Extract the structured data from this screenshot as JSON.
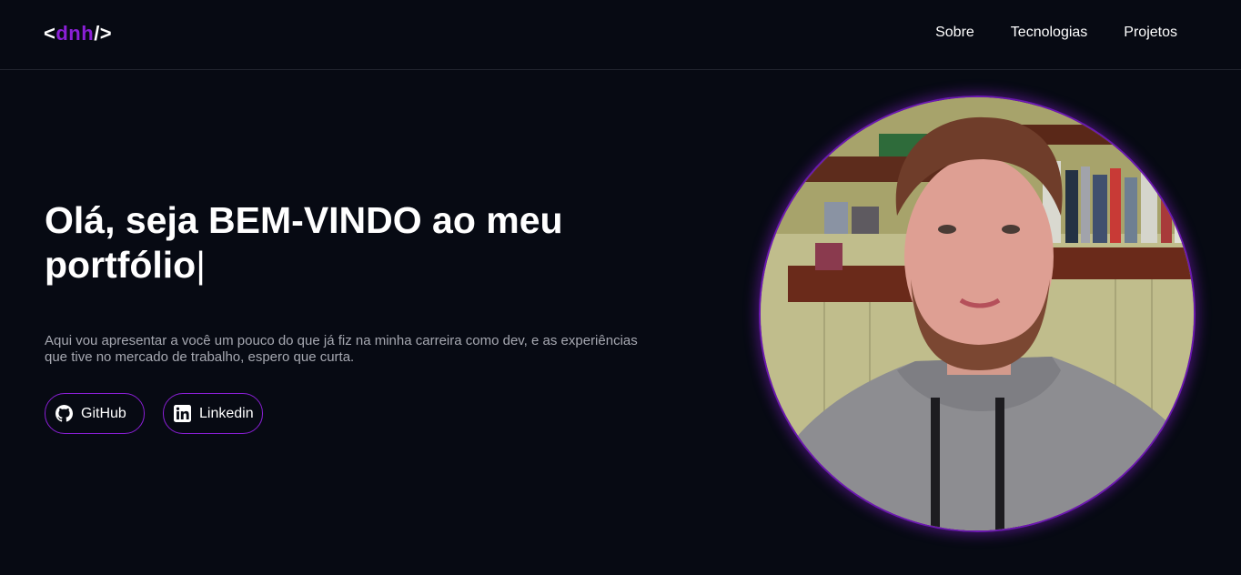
{
  "header": {
    "logo": {
      "open": "<",
      "accent": "dnh",
      "close": "/>"
    },
    "nav": [
      "Sobre",
      "Tecnologias",
      "Projetos"
    ]
  },
  "hero": {
    "title": "Olá, seja BEM-VINDO ao meu portfólio",
    "cursor": "|",
    "description": "Aqui vou apresentar a você um pouco do que já fiz na minha carreira como dev, e as experiências que tive no mercado de trabalho, espero que curta.",
    "buttons": [
      {
        "label": "GitHub",
        "icon": "github-icon"
      },
      {
        "label": "Linkedin",
        "icon": "linkedin-icon"
      }
    ]
  },
  "colors": {
    "background": "#070a13",
    "accent": "#8a1fd6",
    "muted_text": "#a6a8b1"
  }
}
